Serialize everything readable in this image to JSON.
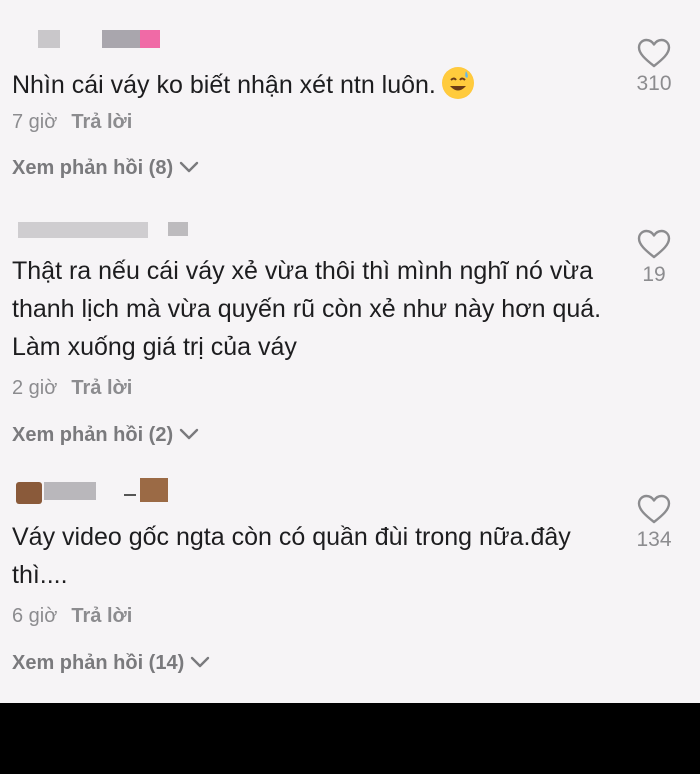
{
  "comments": [
    {
      "text": "Nhìn cái váy ko biết nhận xét ntn luôn.",
      "emoji": "sweat-smile-emoji",
      "time": "7 giờ",
      "reply_label": "Trả lời",
      "view_replies": "Xem phản hồi (8)",
      "likes": "310"
    },
    {
      "text": "Thật ra nếu cái váy xẻ vừa thôi thì mình nghĩ nó vừa thanh lịch mà vừa quyến rũ còn xẻ như này hơn quá. Làm xuống giá trị của váy",
      "time": "2 giờ",
      "reply_label": "Trả lời",
      "view_replies": "Xem phản hồi (2)",
      "likes": "19"
    },
    {
      "text": "Váy video gốc ngta còn có quần đùi trong nữa.đây thì....",
      "time": "6 giờ",
      "reply_label": "Trả lời",
      "view_replies": "Xem phản hồi (14)",
      "likes": "134"
    }
  ],
  "icons": {
    "like": "heart-outline-icon",
    "expand": "chevron-down-icon"
  },
  "colors": {
    "background": "#f6f4f6",
    "text": "#1d1d1f",
    "muted": "#8c8c8f",
    "bottom_bar": "#000000"
  }
}
